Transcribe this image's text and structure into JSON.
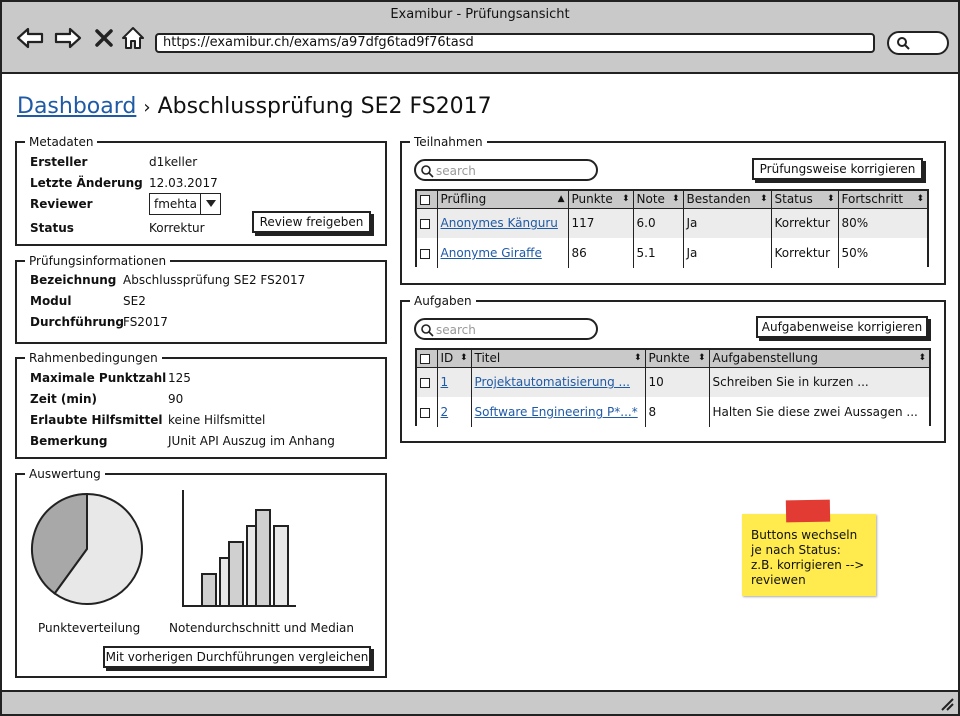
{
  "window": {
    "title": "Examibur - Prüfungsansicht",
    "url": "https://examibur.ch/exams/a97dfg6tad9f76tasd"
  },
  "breadcrumb": {
    "root": "Dashboard",
    "separator": "›",
    "current": "Abschlussprüfung SE2 FS2017"
  },
  "metadaten": {
    "legend": "Metadaten",
    "ersteller_label": "Ersteller",
    "ersteller_value": "d1keller",
    "aenderung_label": "Letzte Änderung",
    "aenderung_value": "12.03.2017",
    "reviewer_label": "Reviewer",
    "reviewer_value": "fmehta",
    "status_label": "Status",
    "status_value": "Korrektur",
    "review_button": "Review freigeben"
  },
  "pruefungsinfo": {
    "legend": "Prüfungsinformationen",
    "bezeichnung_label": "Bezeichnung",
    "bezeichnung_value": "Abschlussprüfung SE2 FS2017",
    "modul_label": "Modul",
    "modul_value": "SE2",
    "durchfuehrung_label": "Durchführung",
    "durchfuehrung_value": "FS2017"
  },
  "rahmen": {
    "legend": "Rahmenbedingungen",
    "punkte_label": "Maximale Punktzahl",
    "punkte_value": "125",
    "zeit_label": "Zeit (min)",
    "zeit_value": "90",
    "hilfsmittel_label": "Erlaubte Hilfsmittel",
    "hilfsmittel_value": "keine Hilfsmittel",
    "bemerkung_label": "Bemerkung",
    "bemerkung_value": "JUnit API Auszug im Anhang"
  },
  "auswertung": {
    "legend": "Auswertung",
    "pie_label": "Punkteverteilung",
    "bar_label": "Notendurchschnitt und Median",
    "compare_button": "Mit vorherigen Durchführungen vergleichen"
  },
  "chart_data": [
    {
      "type": "pie",
      "title": "Punkteverteilung",
      "values": [
        40,
        60
      ],
      "colors": [
        "#a8a8a8",
        "#e8e8e8"
      ]
    },
    {
      "type": "bar",
      "title": "Notendurchschnitt und Median",
      "series": [
        {
          "values": [
            2,
            4,
            6
          ]
        },
        {
          "values": [
            3,
            5,
            5
          ]
        }
      ],
      "ylim": [
        0,
        7
      ]
    }
  ],
  "teilnahmen": {
    "legend": "Teilnahmen",
    "search_placeholder": "search",
    "correct_button": "Prüfungsweise korrigieren",
    "columns": [
      "Prüfling",
      "Punkte",
      "Note",
      "Bestanden",
      "Status",
      "Fortschritt"
    ],
    "rows": [
      {
        "name": "Anonymes Känguru",
        "punkte": "117",
        "note": "6.0",
        "bestanden": "Ja",
        "status": "Korrektur",
        "fortschritt": "80%"
      },
      {
        "name": "Anonyme Giraffe",
        "punkte": "86",
        "note": "5.1",
        "bestanden": "Ja",
        "status": "Korrektur",
        "fortschritt": "50%"
      }
    ]
  },
  "aufgaben": {
    "legend": "Aufgaben",
    "search_placeholder": "search",
    "correct_button": "Aufgabenweise korrigieren",
    "columns": [
      "ID",
      "Titel",
      "Punkte",
      "Aufgabenstellung"
    ],
    "rows": [
      {
        "id": "1",
        "titel": "Projektautomatisierung ...",
        "punkte": "10",
        "aufgabe": "Schreiben Sie in kurzen ..."
      },
      {
        "id": "2",
        "titel": "Software Engineering P*...*",
        "punkte": "8",
        "aufgabe": "Halten Sie diese zwei Aussagen ..."
      }
    ]
  },
  "note": {
    "text_lines": [
      "Buttons wechseln",
      "je nach Status:",
      "z.B. korrigieren -->",
      "reviewen"
    ]
  }
}
